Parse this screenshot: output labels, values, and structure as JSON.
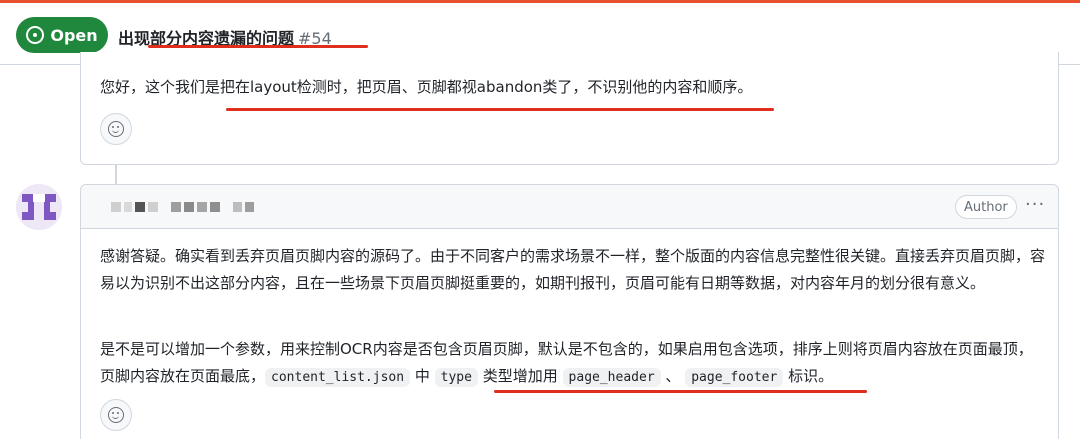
{
  "issue": {
    "state": "Open",
    "title": "出现部分内容遗漏的问题",
    "number": "#54"
  },
  "comment1": {
    "text": "您好，这个我们是把在layout检测时，把页眉、页脚都视abandon类了，不识别他的内容和顺序。"
  },
  "comment2": {
    "author_badge": "Author",
    "more_label": "···",
    "paragraph1": "感谢答疑。确实看到丢弃页眉页脚内容的源码了。由于不同客户的需求场景不一样，整个版面的内容信息完整性很关键。直接丢弃页眉页脚，容易以为识别不出这部分内容，且在一些场景下页眉页脚挺重要的，如期刊报刊，页眉可能有日期等数据，对内容年月的划分很有意义。",
    "paragraph2_prefix": "是不是可以增加一个参数，用来控制OCR内容是否包含页眉页脚，默认是不包含的，如果启用包含选项，排序上则将页眉内容放在页面最顶，页脚内容放在页面最底，",
    "code_content_list": "content_list.json",
    "text_zhong": "中",
    "code_type": "type",
    "text_type_desc": "类型增加用",
    "code_page_header": "page_header",
    "text_sep": "、",
    "code_page_footer": "page_footer",
    "text_suffix": "标识。"
  },
  "colors": {
    "open_badge": "#1f883d",
    "annotation_red": "#e02e1e",
    "top_accent": "#e8502e",
    "avatar_purple": "#7e57c2"
  },
  "icons": [
    "open-issue-icon",
    "smile-reaction-icon",
    "kebab-more-icon"
  ]
}
